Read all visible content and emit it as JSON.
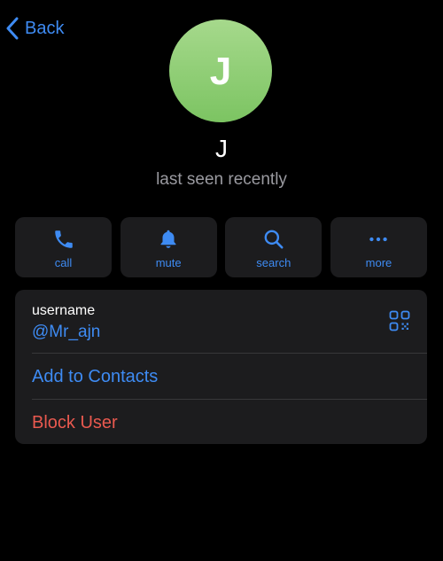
{
  "nav": {
    "back_label": "Back"
  },
  "profile": {
    "avatar_initial": "J",
    "avatar_color": "#8fce75",
    "name": "J",
    "status": "last seen recently"
  },
  "actions": [
    {
      "label": "call",
      "icon": "phone-icon"
    },
    {
      "label": "mute",
      "icon": "bell-icon"
    },
    {
      "label": "search",
      "icon": "search-icon"
    },
    {
      "label": "more",
      "icon": "ellipsis-icon"
    }
  ],
  "info": {
    "username_label": "username",
    "username_value": "@Mr_ajn",
    "qr_icon": "qr-code-icon",
    "add_contact_label": "Add to Contacts",
    "block_label": "Block User"
  },
  "colors": {
    "accent": "#3e8bf3",
    "danger": "#e9594f",
    "card_background": "#1c1c1e",
    "background": "#000000"
  }
}
